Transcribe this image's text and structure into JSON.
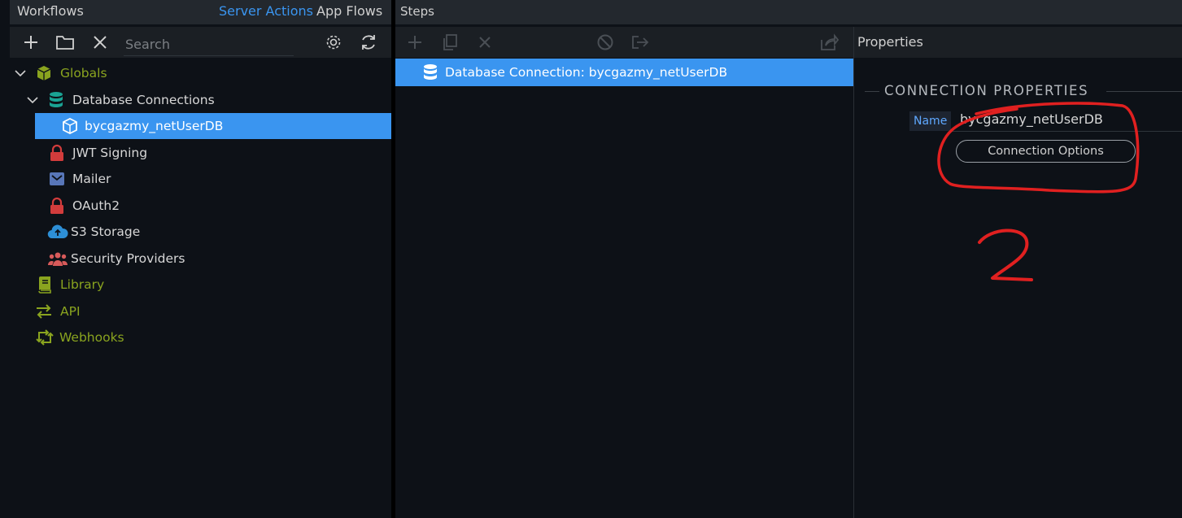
{
  "workflows_panel": {
    "title": "Workflows",
    "tabs": [
      {
        "label": "Server Actions",
        "active": true
      },
      {
        "label": "App Flows",
        "active": false
      }
    ],
    "toolbar": {
      "add_icon": "plus-icon",
      "folder_icon": "folder-icon",
      "close_icon": "close-icon",
      "search_placeholder": "Search",
      "settings_icon": "gear-icon",
      "refresh_icon": "refresh-icon"
    },
    "tree": [
      {
        "label": "Globals",
        "icon": "cube-icon"
      },
      {
        "label": "Database Connections",
        "icon": "database-icon"
      },
      {
        "label": "bycgazmy_netUserDB",
        "icon": "cube-icon",
        "selected": true
      },
      {
        "label": "JWT Signing",
        "icon": "lock-icon"
      },
      {
        "label": "Mailer",
        "icon": "envelope-icon"
      },
      {
        "label": "OAuth2",
        "icon": "lock-icon"
      },
      {
        "label": "S3 Storage",
        "icon": "cloud-upload-icon"
      },
      {
        "label": "Security Providers",
        "icon": "users-icon"
      },
      {
        "label": "Library",
        "icon": "book-icon"
      },
      {
        "label": "API",
        "icon": "exchange-icon"
      },
      {
        "label": "Webhooks",
        "icon": "retweet-icon"
      }
    ]
  },
  "steps_panel": {
    "title": "Steps",
    "steps": [
      {
        "label": "Database Connection: bycgazmy_netUserDB",
        "icon": "database-icon",
        "selected": true
      }
    ]
  },
  "properties_panel": {
    "title": "Properties",
    "section_title": "CONNECTION PROPERTIES",
    "name_label": "Name",
    "name_value": "bycgazmy_netUserDB",
    "connection_options_label": "Connection Options"
  },
  "annotation": {
    "text": "2",
    "color": "#e02020"
  },
  "colors": {
    "accent": "#3a95f0",
    "green": "#8aa41f",
    "teal": "#1aa394",
    "red": "#d23c3c"
  }
}
